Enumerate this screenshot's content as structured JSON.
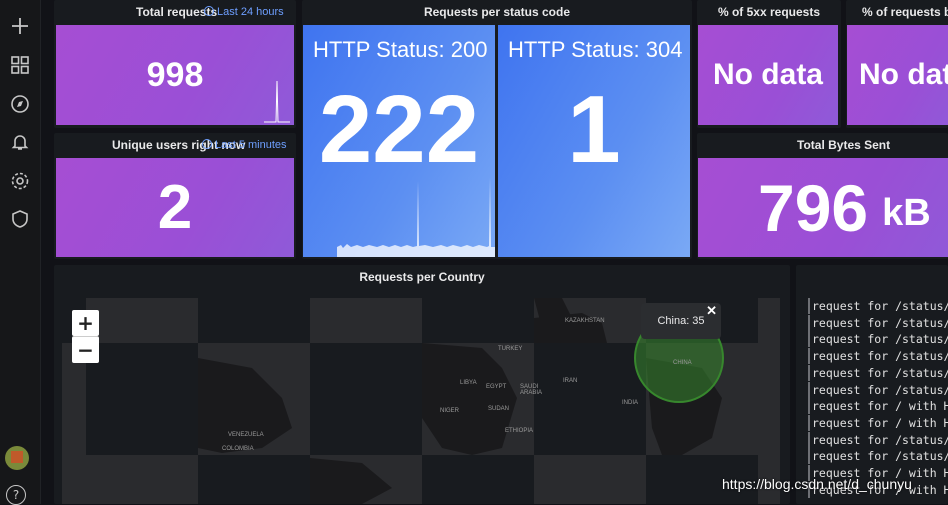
{
  "sidebar": {
    "icons": [
      "plus-icon",
      "dashboards-icon",
      "explore-icon",
      "alerting-icon",
      "configuration-icon",
      "shield-icon"
    ],
    "help_label": "?"
  },
  "panels": {
    "total_requests": {
      "title": "Total requests",
      "time_note": "Last 24 hours",
      "value": "998"
    },
    "requests_per_status": {
      "title": "Requests per status code",
      "items": [
        {
          "label": "HTTP Status: 200",
          "value": "222"
        },
        {
          "label": "HTTP Status: 304",
          "value": "1"
        }
      ]
    },
    "pct_5xx": {
      "title": "% of 5xx requests",
      "value": "No data"
    },
    "pct_requests": {
      "title": "% of requests by",
      "value": "No dat"
    },
    "unique_users": {
      "title": "Unique users right now",
      "time_note": "Last 5 minutes",
      "value": "2"
    },
    "total_bytes": {
      "title": "Total Bytes Sent",
      "value": "796",
      "unit": "kB"
    },
    "requests_per_country": {
      "title": "Requests per Country",
      "zoom_in": "+",
      "zoom_out": "−",
      "tooltip": "China: 35",
      "tooltip_close": "✕",
      "map_labels": [
        "KAZAKHSTAN",
        "TURKEY",
        "IRAN",
        "LIBYA",
        "EGYPT",
        "SAUDI ARABIA",
        "NIGER",
        "SUDAN",
        "ETHIOPIA",
        "VENEZUELA",
        "COLOMBIA",
        "INDIA",
        "CHINA"
      ]
    }
  },
  "logs": {
    "lines": [
      "request for /status/fo",
      "request for /status/fo",
      "request for /status/fo",
      "request for /status/fo",
      "request for /status/fo",
      "request for /status/fo",
      "request for / with HTT",
      "request for / with HTT",
      "request for /status/fo",
      "request for /status/fo",
      "request for / with HTT",
      "request for / with HTT"
    ]
  },
  "watermark": "https://blog.csdn.net/d_chunyu",
  "colors": {
    "stat_purple": "#a64ed3",
    "stat_blue": "#3f74f0",
    "link_blue": "#6e9fff",
    "map_marker": "#37872d"
  }
}
